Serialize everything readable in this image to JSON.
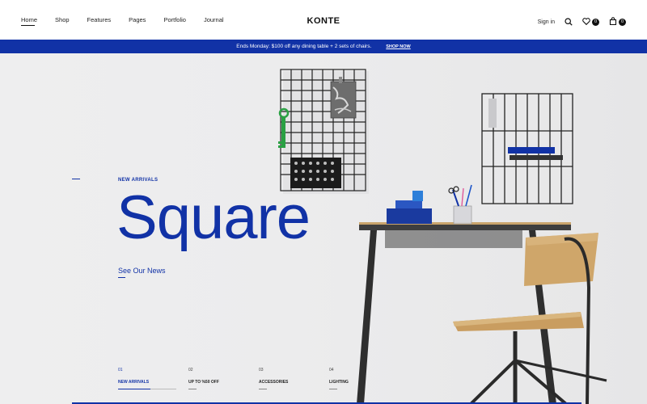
{
  "header": {
    "nav": [
      {
        "label": "Home",
        "active": true
      },
      {
        "label": "Shop"
      },
      {
        "label": "Features"
      },
      {
        "label": "Pages"
      },
      {
        "label": "Portfolio"
      },
      {
        "label": "Journal"
      }
    ],
    "logo": "KONTE",
    "signin": "Sign in",
    "wishlist_count": "0",
    "cart_count": "0"
  },
  "promo": {
    "text": "Ends Monday: $100 off any dining table + 2 sets of chairs.",
    "link": "SHOP NOW"
  },
  "hero": {
    "eyebrow": "NEW ARRIVALS",
    "title": "Square",
    "cta": "See Our News",
    "slides": [
      {
        "num": "01",
        "label": "NEW ARRIVALS"
      },
      {
        "num": "02",
        "label": "UP TO %50 OFF"
      },
      {
        "num": "03",
        "label": "ACCESSORIES"
      },
      {
        "num": "04",
        "label": "LIGHTING"
      }
    ]
  },
  "colors": {
    "accent": "#1132a6",
    "background": "#ececed"
  }
}
